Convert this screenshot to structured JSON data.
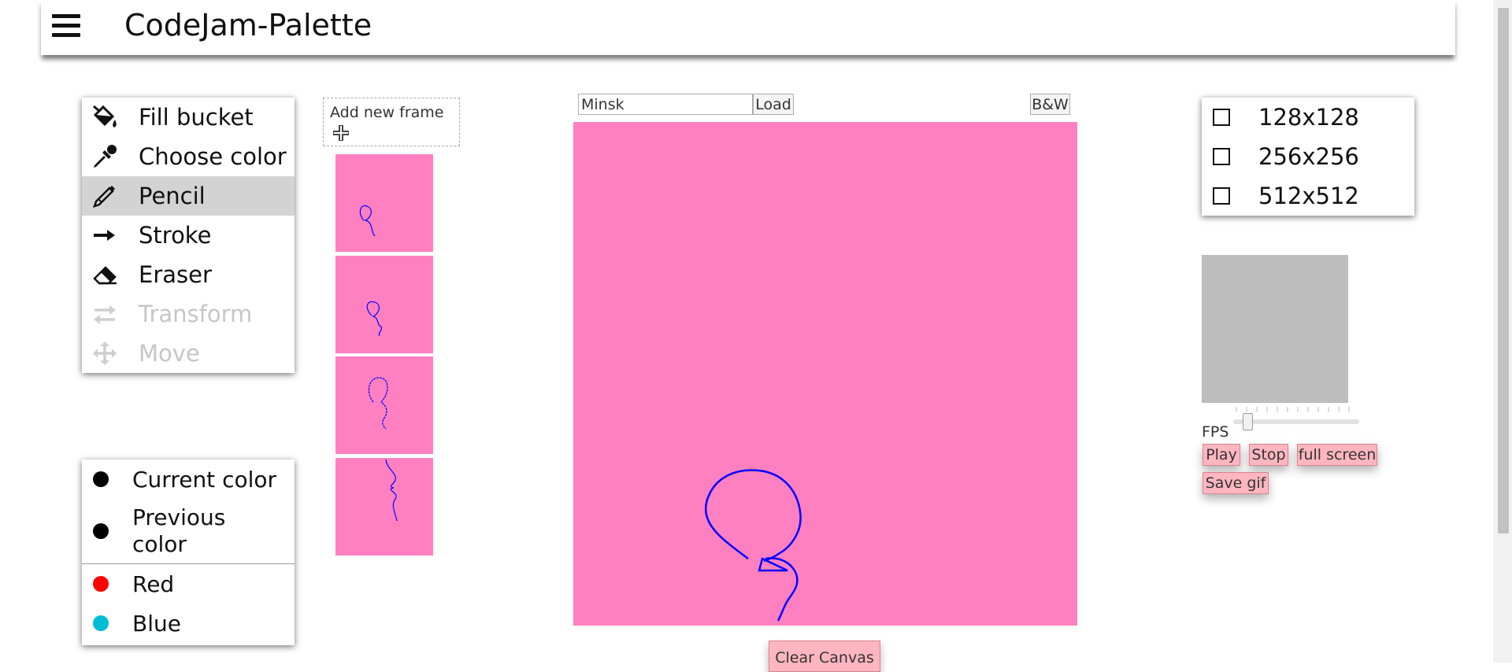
{
  "header": {
    "title": "CodeJam-Palette",
    "menu_icon": "hamburger-menu-icon"
  },
  "tools": [
    {
      "label": "Fill bucket",
      "icon": "paint-bucket-icon",
      "state": "normal"
    },
    {
      "label": "Choose color",
      "icon": "eyedropper-icon",
      "state": "normal"
    },
    {
      "label": "Pencil",
      "icon": "pencil-icon",
      "state": "active"
    },
    {
      "label": "Stroke",
      "icon": "arrow-right-icon",
      "state": "normal"
    },
    {
      "label": "Eraser",
      "icon": "eraser-icon",
      "state": "normal"
    },
    {
      "label": "Transform",
      "icon": "transform-arrows-icon",
      "state": "disabled"
    },
    {
      "label": "Move",
      "icon": "move-arrows-icon",
      "state": "disabled"
    }
  ],
  "colors": {
    "current": {
      "label": "Current color",
      "color": "#000000"
    },
    "previous": {
      "label_line1": "Previous",
      "label_line2": "color",
      "color": "#000000"
    },
    "presets": [
      {
        "label": "Red",
        "color": "#ff0000"
      },
      {
        "label": "Blue",
        "color": "#00bcd4"
      }
    ]
  },
  "frames": {
    "add_label": "Add new frame",
    "add_icon": "plus-icon",
    "count": 4,
    "background": "#ff80c0",
    "stroke_color": "#0000ff"
  },
  "canvas": {
    "city_input_value": "Minsk",
    "load_label": "Load",
    "bw_label": "B&W",
    "background": "#ff80c0",
    "stroke_color": "#0000ff",
    "clear_label": "Clear Canvas"
  },
  "sizes": [
    {
      "label": "128x128",
      "checked": false
    },
    {
      "label": "256x256",
      "checked": false
    },
    {
      "label": "512x512",
      "checked": false
    }
  ],
  "preview": {
    "background": "#bdbdbd",
    "fps_label": "FPS",
    "fps_value_fraction": 0.08,
    "play_label": "Play",
    "stop_label": "Stop",
    "fullscreen_label": "full screen",
    "savegif_label": "Save gif"
  }
}
